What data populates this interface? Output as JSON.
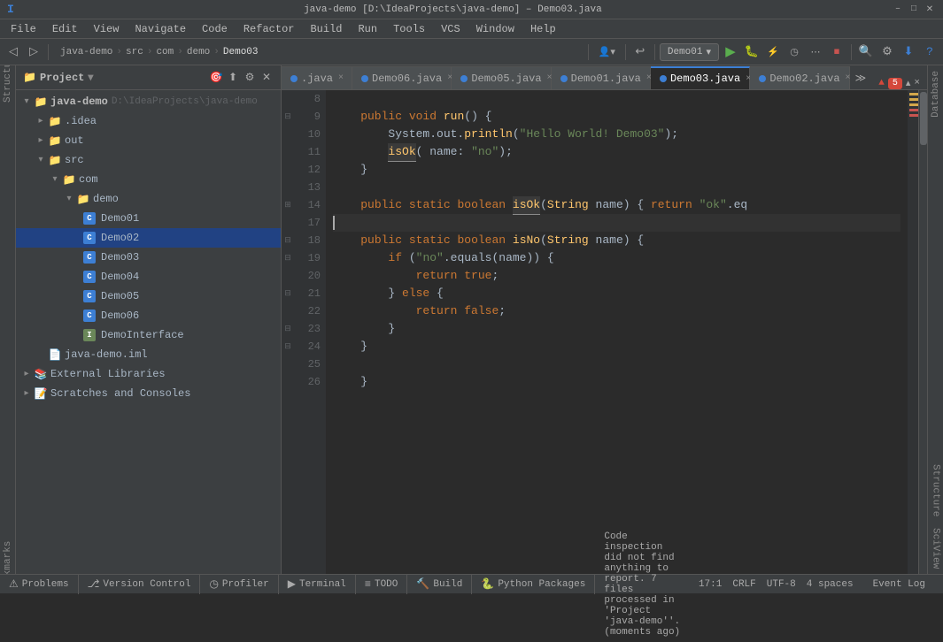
{
  "titlebar": {
    "title": "java-demo [D:\\IdeaProjects\\java-demo] – Demo03.java",
    "controls": [
      "–",
      "□",
      "✕"
    ]
  },
  "menubar": {
    "items": [
      "File",
      "Edit",
      "View",
      "Navigate",
      "Code",
      "Refactor",
      "Build",
      "Run",
      "Tools",
      "VCS",
      "Window",
      "Help"
    ]
  },
  "toolbar": {
    "breadcrumb": [
      "java-demo",
      "src",
      "com",
      "demo",
      "Demo03"
    ],
    "run_config": "Demo01",
    "run_config_arrow": "▾"
  },
  "tabs": [
    {
      "label": ".java",
      "active": false,
      "modified": false
    },
    {
      "label": "Demo06.java",
      "active": false,
      "modified": false
    },
    {
      "label": "Demo05.java",
      "active": false,
      "modified": false
    },
    {
      "label": "Demo01.java",
      "active": false,
      "modified": false
    },
    {
      "label": "Demo03.java",
      "active": true,
      "modified": false
    },
    {
      "label": "Demo02.java",
      "active": false,
      "modified": false
    }
  ],
  "errors_badge": "▲ 5",
  "project": {
    "header": "Project",
    "tree": [
      {
        "level": 0,
        "label": "java-demo",
        "path": "D:\\IdeaProjects\\java-demo",
        "type": "root",
        "expanded": true
      },
      {
        "level": 1,
        "label": ".idea",
        "type": "folder",
        "expanded": false
      },
      {
        "level": 1,
        "label": "out",
        "type": "folder",
        "expanded": true
      },
      {
        "level": 1,
        "label": "src",
        "type": "folder",
        "expanded": true
      },
      {
        "level": 2,
        "label": "com",
        "type": "folder",
        "expanded": true
      },
      {
        "level": 3,
        "label": "demo",
        "type": "folder",
        "expanded": true
      },
      {
        "level": 4,
        "label": "Demo01",
        "type": "java"
      },
      {
        "level": 4,
        "label": "Demo02",
        "type": "java",
        "selected": true
      },
      {
        "level": 4,
        "label": "Demo03",
        "type": "java"
      },
      {
        "level": 4,
        "label": "Demo04",
        "type": "java"
      },
      {
        "level": 4,
        "label": "Demo05",
        "type": "java"
      },
      {
        "level": 4,
        "label": "Demo06",
        "type": "java"
      },
      {
        "level": 4,
        "label": "DemoInterface",
        "type": "interface"
      },
      {
        "level": 1,
        "label": "java-demo.iml",
        "type": "xml"
      },
      {
        "level": 0,
        "label": "External Libraries",
        "type": "folder",
        "expanded": false
      },
      {
        "level": 0,
        "label": "Scratches and Consoles",
        "type": "folder",
        "expanded": false
      }
    ]
  },
  "code": {
    "lines": [
      {
        "num": 8,
        "content": "",
        "indent": 0
      },
      {
        "num": 9,
        "content": "    public void run() {",
        "tokens": [
          {
            "t": "kw",
            "v": "public"
          },
          {
            "t": "txt",
            "v": " "
          },
          {
            "t": "kw",
            "v": "void"
          },
          {
            "t": "txt",
            "v": " "
          },
          {
            "t": "fn",
            "v": "run"
          },
          {
            "t": "txt",
            "v": "() {"
          }
        ]
      },
      {
        "num": 10,
        "content": "        System.out.println(\"Hello World! Demo03\");",
        "tokens": [
          {
            "t": "txt",
            "v": "        System.out."
          },
          {
            "t": "fn",
            "v": "println"
          },
          {
            "t": "txt",
            "v": "("
          },
          {
            "t": "str",
            "v": "\"Hello World! Demo03\""
          },
          {
            "t": "txt",
            "v": ");"
          }
        ]
      },
      {
        "num": 11,
        "content": "        isOk( name: \"no\");",
        "tokens": [
          {
            "t": "txt",
            "v": "        "
          },
          {
            "t": "fn",
            "v": "isOk"
          },
          {
            "t": "txt",
            "v": "( name: "
          },
          {
            "t": "str",
            "v": "\"no\""
          },
          {
            "t": "txt",
            "v": ");"
          }
        ]
      },
      {
        "num": 12,
        "content": "    }",
        "tokens": [
          {
            "t": "txt",
            "v": "    }"
          }
        ]
      },
      {
        "num": 13,
        "content": "",
        "indent": 0
      },
      {
        "num": 14,
        "content": "    public static boolean isOk(String name) { return \"ok\".eq",
        "tokens": [
          {
            "t": "txt",
            "v": "    "
          },
          {
            "t": "kw",
            "v": "public"
          },
          {
            "t": "txt",
            "v": " "
          },
          {
            "t": "kw",
            "v": "static"
          },
          {
            "t": "txt",
            "v": " "
          },
          {
            "t": "kw",
            "v": "boolean"
          },
          {
            "t": "txt",
            "v": " "
          },
          {
            "t": "fn",
            "v": "isOk"
          },
          {
            "t": "txt",
            "v": "("
          },
          {
            "t": "cls",
            "v": "String"
          },
          {
            "t": "txt",
            "v": " name) { "
          },
          {
            "t": "kw",
            "v": "return"
          },
          {
            "t": "txt",
            "v": " "
          },
          {
            "t": "str",
            "v": "\"ok\""
          },
          {
            "t": "txt",
            "v": ".eq"
          }
        ]
      },
      {
        "num": 17,
        "content": "",
        "current": true
      },
      {
        "num": 18,
        "content": "    public static boolean isNo(String name) {",
        "tokens": [
          {
            "t": "txt",
            "v": "    "
          },
          {
            "t": "kw",
            "v": "public"
          },
          {
            "t": "txt",
            "v": " "
          },
          {
            "t": "kw",
            "v": "static"
          },
          {
            "t": "txt",
            "v": " "
          },
          {
            "t": "kw",
            "v": "boolean"
          },
          {
            "t": "txt",
            "v": " "
          },
          {
            "t": "fn",
            "v": "isNo"
          },
          {
            "t": "txt",
            "v": "("
          },
          {
            "t": "cls",
            "v": "String"
          },
          {
            "t": "txt",
            "v": " name) {"
          }
        ]
      },
      {
        "num": 19,
        "content": "        if (\"no\".equals(name)) {",
        "tokens": [
          {
            "t": "txt",
            "v": "        "
          },
          {
            "t": "kw",
            "v": "if"
          },
          {
            "t": "txt",
            "v": " ("
          },
          {
            "t": "str",
            "v": "\"no\""
          },
          {
            "t": "txt",
            "v": ".equals(name)) {"
          }
        ]
      },
      {
        "num": 20,
        "content": "            return true;",
        "tokens": [
          {
            "t": "txt",
            "v": "            "
          },
          {
            "t": "kw",
            "v": "return"
          },
          {
            "t": "txt",
            "v": " "
          },
          {
            "t": "kw",
            "v": "true"
          },
          {
            "t": "txt",
            "v": ";"
          }
        ]
      },
      {
        "num": 21,
        "content": "        } else {",
        "tokens": [
          {
            "t": "txt",
            "v": "        } "
          },
          {
            "t": "kw",
            "v": "else"
          },
          {
            "t": "txt",
            "v": " {"
          }
        ]
      },
      {
        "num": 22,
        "content": "            return false;",
        "tokens": [
          {
            "t": "txt",
            "v": "            "
          },
          {
            "t": "kw",
            "v": "return"
          },
          {
            "t": "txt",
            "v": " "
          },
          {
            "t": "kw",
            "v": "false"
          },
          {
            "t": "txt",
            "v": ";"
          }
        ]
      },
      {
        "num": 23,
        "content": "        }",
        "tokens": [
          {
            "t": "txt",
            "v": "        }"
          }
        ]
      },
      {
        "num": 24,
        "content": "    }",
        "tokens": [
          {
            "t": "txt",
            "v": "    }"
          }
        ]
      },
      {
        "num": 25,
        "content": ""
      },
      {
        "num": 26,
        "content": "    }",
        "tokens": [
          {
            "t": "txt",
            "v": "    }"
          }
        ]
      }
    ]
  },
  "statusbar": {
    "bottom_tabs": [
      {
        "icon": "⚠",
        "label": "Problems"
      },
      {
        "icon": "⎇",
        "label": "Version Control"
      },
      {
        "icon": "◷",
        "label": "Profiler"
      },
      {
        "icon": "▶",
        "label": "Terminal"
      },
      {
        "icon": "≡",
        "label": "TODO"
      },
      {
        "icon": "🔨",
        "label": "Build"
      },
      {
        "icon": "🐍",
        "label": "Python Packages"
      }
    ],
    "event_log": "Event Log",
    "status_msg": "Code inspection did not find anything to report. 7 files processed in 'Project 'java-demo''. (moments ago)",
    "position": "17:1",
    "line_sep": "CRLF",
    "encoding": "UTF-8",
    "indent": "4 spaces"
  },
  "right_panels": {
    "database": "Database",
    "structure": "Structure",
    "scview": "SciView"
  },
  "left_strip": {
    "bookmarks": "Bookmarks",
    "structure_left": "Structure"
  }
}
